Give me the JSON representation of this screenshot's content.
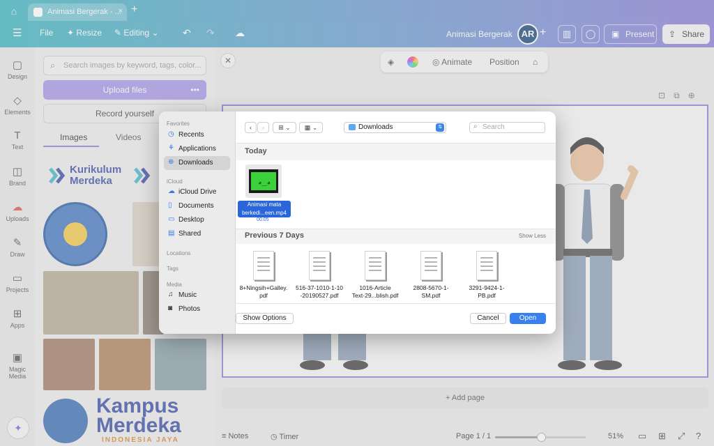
{
  "browser": {
    "tab_title": "Animasi Bergerak - ...",
    "tab_close": "×",
    "new_tab": "+"
  },
  "topbar": {
    "file": "File",
    "resize": "Resize",
    "editing": "Editing",
    "title": "Animasi Bergerak",
    "avatar": "AR",
    "present": "Present",
    "share": "Share"
  },
  "rail": {
    "items": [
      {
        "label": "Design",
        "icon": "design-icon"
      },
      {
        "label": "Elements",
        "icon": "elements-icon"
      },
      {
        "label": "Text",
        "icon": "text-icon"
      },
      {
        "label": "Brand",
        "icon": "brand-icon"
      },
      {
        "label": "Uploads",
        "icon": "uploads-icon"
      },
      {
        "label": "Draw",
        "icon": "draw-icon"
      },
      {
        "label": "Projects",
        "icon": "projects-icon"
      },
      {
        "label": "Apps",
        "icon": "apps-icon"
      },
      {
        "label": "Magic Media",
        "icon": "magic-media-icon"
      }
    ]
  },
  "panel": {
    "search_placeholder": "Search images by keyword, tags, color...",
    "upload": "Upload files",
    "record": "Record yourself",
    "tabs": [
      "Images",
      "Videos"
    ],
    "logo_text_1": "Kurikulum",
    "logo_text_2": "Merdeka",
    "kampus_1": "Kampus",
    "kampus_2": "Merdeka",
    "kampus_3": "INDONESIA JAYA"
  },
  "editor": {
    "ctx": {
      "animate": "Animate",
      "position": "Position"
    },
    "add_page": "+ Add page",
    "notes": "Notes",
    "timer": "Timer",
    "page_indicator": "Page 1 / 1",
    "zoom": "51%",
    "zoom_fraction": 0.51
  },
  "dialog": {
    "sidebar": {
      "favorites": "Favorites",
      "fav_items": [
        "Recents",
        "Applications",
        "Downloads"
      ],
      "icloud": "iCloud",
      "icloud_items": [
        "iCloud Drive",
        "Documents",
        "Desktop",
        "Shared"
      ],
      "locations": "Locations",
      "tags": "Tags",
      "media": "Media",
      "media_items": [
        "Music",
        "Photos"
      ]
    },
    "location": "Downloads",
    "search_placeholder": "Search",
    "today": "Today",
    "today_file": {
      "name_line1": "Animasi mata",
      "name_line2": "berkedi...een.mp4",
      "duration": "00:05"
    },
    "prev_section": "Previous 7 Days",
    "show_less": "Show Less",
    "pdfs": [
      {
        "l1": "8+Ningsih+Galley.",
        "l2": "pdf"
      },
      {
        "l1": "516-37-1010-1-10",
        "l2": "-20190527.pdf"
      },
      {
        "l1": "1016-Article",
        "l2": "Text-29...blish.pdf"
      },
      {
        "l1": "2808-5670-1-",
        "l2": "SM.pdf"
      },
      {
        "l1": "3291-9424-1-",
        "l2": "PB.pdf"
      }
    ],
    "show_options": "Show Options",
    "cancel": "Cancel",
    "open": "Open"
  }
}
